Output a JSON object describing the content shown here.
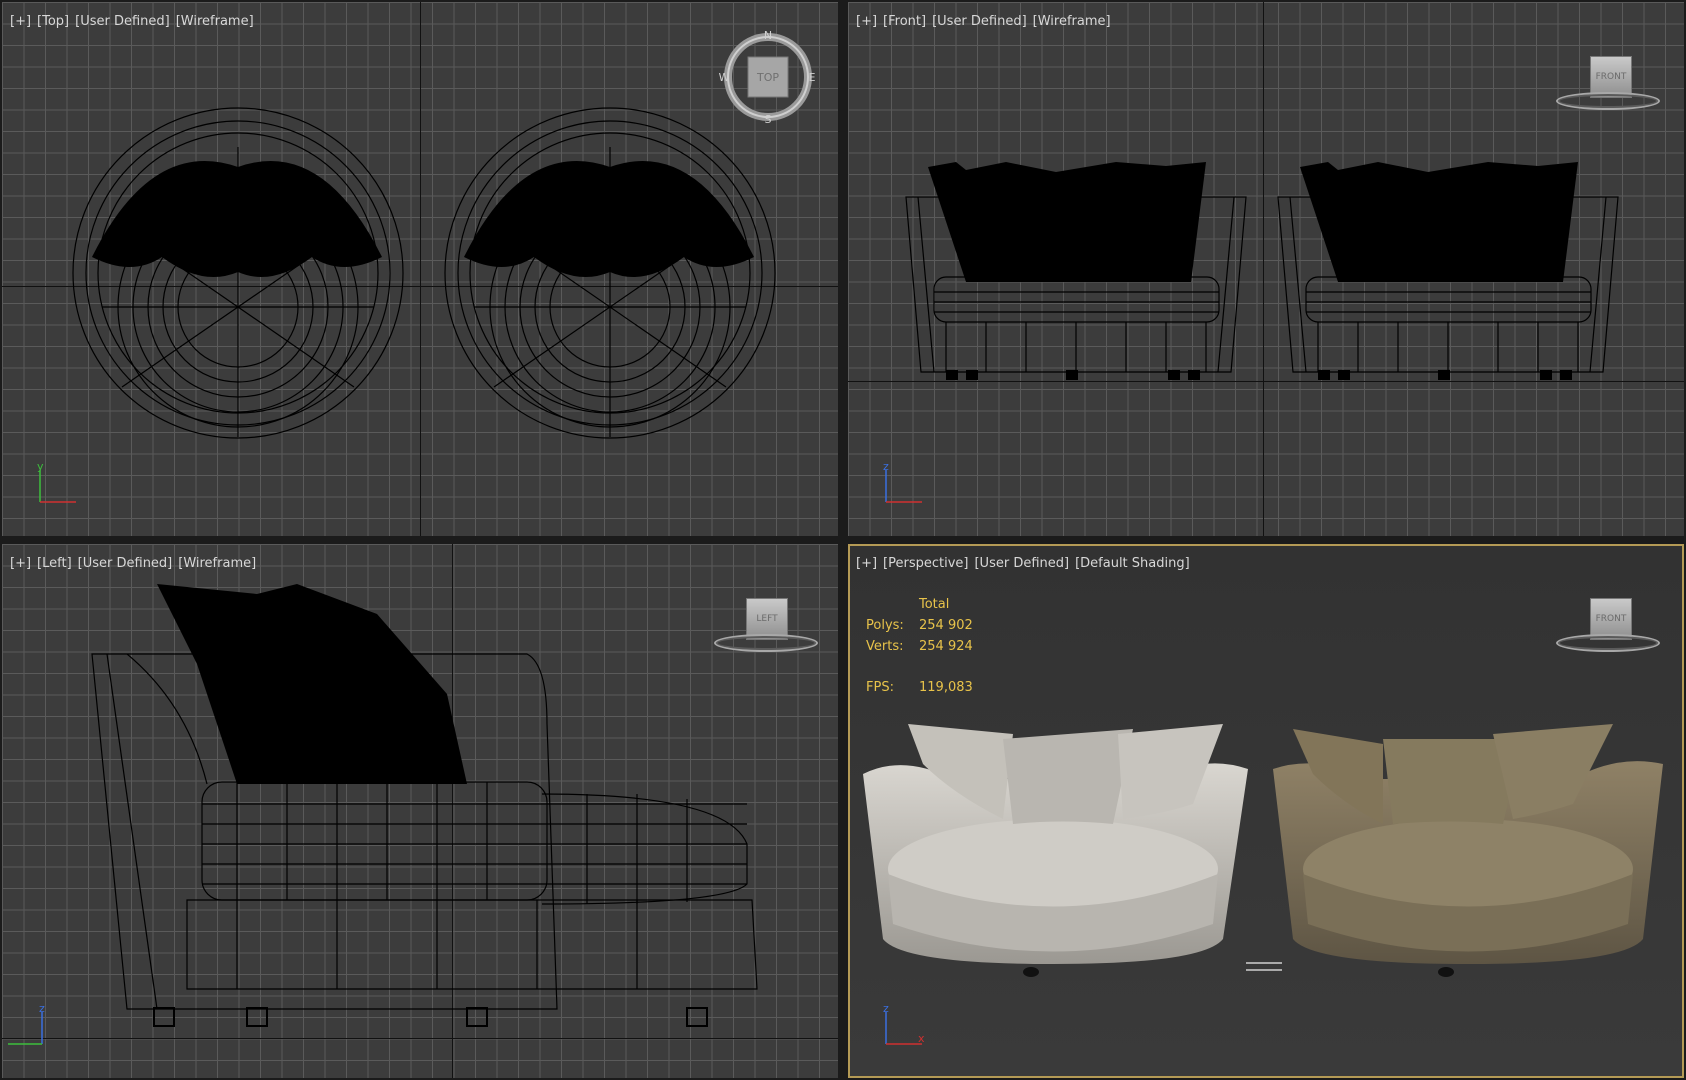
{
  "viewports": {
    "top": {
      "labels": [
        "[+]",
        "[Top]",
        "[User Defined]",
        "[Wireframe]"
      ],
      "navcube": "TOP",
      "compass": {
        "n": "N",
        "s": "S",
        "e": "E",
        "w": "W"
      },
      "axes": {
        "up": "y",
        "right": "x"
      }
    },
    "front": {
      "labels": [
        "[+]",
        "[Front]",
        "[User Defined]",
        "[Wireframe]"
      ],
      "navcube": "FRONT",
      "axes": {
        "up": "z",
        "right": "x"
      }
    },
    "left": {
      "labels": [
        "[+]",
        "[Left]",
        "[User Defined]",
        "[Wireframe]"
      ],
      "navcube": "LEFT",
      "axes": {
        "up": "z",
        "left": "y"
      }
    },
    "perspective": {
      "labels": [
        "[+]",
        "[Perspective]",
        "[User Defined]",
        "[Default Shading]"
      ],
      "navcube": "FRONT",
      "axes": {
        "up": "z",
        "right": "x"
      },
      "stats": {
        "header": "Total",
        "polys_label": "Polys:",
        "polys_value": "254 902",
        "verts_label": "Verts:",
        "verts_value": "254 924",
        "fps_label": "FPS:",
        "fps_value": "119,083"
      }
    }
  },
  "colors": {
    "active_border": "#b49a55",
    "stats_text": "#e8c34a",
    "chair_light": "#c9c6c0",
    "chair_tan": "#8f8166"
  }
}
